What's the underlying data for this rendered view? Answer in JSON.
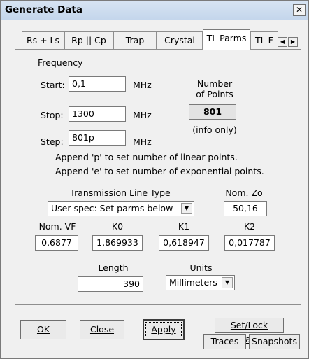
{
  "window": {
    "title": "Generate Data",
    "close_glyph": "✕"
  },
  "tabs": [
    {
      "label": "Rs + Ls"
    },
    {
      "label": "Rp || Cp"
    },
    {
      "label": "Trap"
    },
    {
      "label": "Crystal"
    },
    {
      "label": "TL Parms"
    },
    {
      "label": "TL F"
    }
  ],
  "tab_scroll": {
    "left": "◀",
    "right": "▶"
  },
  "frequency": {
    "section_label": "Frequency",
    "start_label": "Start:",
    "start_value": "0,1",
    "stop_label": "Stop:",
    "stop_value": "1300",
    "step_label": "Step:",
    "step_value": "801p",
    "unit": "MHz"
  },
  "points": {
    "label_line1": "Number",
    "label_line2": "of Points",
    "value": "801",
    "note": "(info only)"
  },
  "hints": {
    "line1": "Append 'p' to set number of linear points.",
    "line2": "Append 'e' to set number of exponential points."
  },
  "tl_type": {
    "label": "Transmission Line Type",
    "selected": "User spec: Set parms below",
    "arrow": "▼"
  },
  "nom_zo": {
    "label": "Nom. Zo",
    "value": "50,16"
  },
  "params": {
    "vf_label": "Nom. VF",
    "vf_value": "0,6877",
    "k0_label": "K0",
    "k0_value": "1,869933",
    "k1_label": "K1",
    "k1_value": "0,618947",
    "k2_label": "K2",
    "k2_value": "0,017787"
  },
  "length": {
    "label": "Length",
    "value": "390"
  },
  "units": {
    "label": "Units",
    "selected": "Millimeters",
    "arrow": "▼"
  },
  "buttons": {
    "ok": "OK",
    "close": "Close",
    "apply": "Apply",
    "set_lock_scales": "Set/Lock Scales",
    "traces": "Traces",
    "snapshots": "Snapshots"
  }
}
